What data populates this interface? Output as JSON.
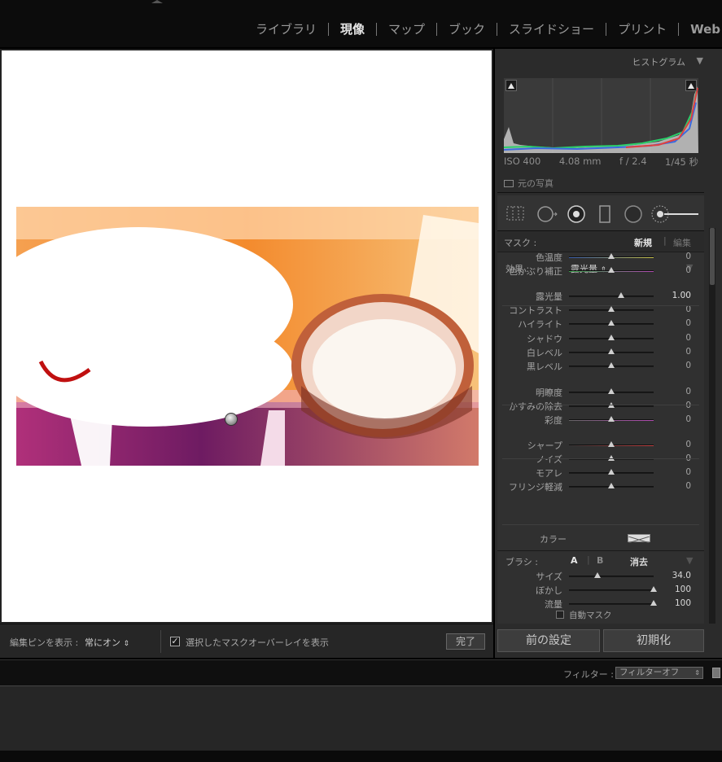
{
  "modules": [
    {
      "label": "ライブラリ",
      "active": false
    },
    {
      "label": "現像",
      "active": true
    },
    {
      "label": "マップ",
      "active": false
    },
    {
      "label": "ブック",
      "active": false
    },
    {
      "label": "スライドショー",
      "active": false
    },
    {
      "label": "プリント",
      "active": false
    },
    {
      "label": "Web",
      "active": false
    }
  ],
  "histogram": {
    "title": "ヒストグラム",
    "iso": "ISO 400",
    "focal": "4.08 mm",
    "aperture": "f / 2.4",
    "shutter": "1/45 秒",
    "original_label": "元の写真"
  },
  "mask": {
    "label": "マスク :",
    "new": "新規",
    "edit": "編集"
  },
  "effect": {
    "label": "効果 :",
    "preset": "露光量",
    "color_label": "カラー"
  },
  "sliders": [
    {
      "label": "色温度",
      "value": "0",
      "pos": 0.5,
      "style": "temp"
    },
    {
      "label": "色かぶり補正",
      "value": "0",
      "pos": 0.5,
      "style": "tint"
    },
    {
      "label": "露光量",
      "value": "1.00",
      "pos": 0.62,
      "style": "plain",
      "bright": true
    },
    {
      "label": "コントラスト",
      "value": "0",
      "pos": 0.5,
      "style": "plain"
    },
    {
      "label": "ハイライト",
      "value": "0",
      "pos": 0.5,
      "style": "plain"
    },
    {
      "label": "シャドウ",
      "value": "0",
      "pos": 0.5,
      "style": "plain"
    },
    {
      "label": "白レベル",
      "value": "0",
      "pos": 0.5,
      "style": "plain"
    },
    {
      "label": "黒レベル",
      "value": "0",
      "pos": 0.5,
      "style": "plain"
    },
    {
      "label": "明瞭度",
      "value": "0",
      "pos": 0.5,
      "style": "plain"
    },
    {
      "label": "かすみの除去",
      "value": "0",
      "pos": 0.5,
      "style": "plain"
    },
    {
      "label": "彩度",
      "value": "0",
      "pos": 0.5,
      "style": "sat"
    },
    {
      "label": "シャープ",
      "value": "0",
      "pos": 0.5,
      "style": "sharp"
    },
    {
      "label": "ノイズ",
      "value": "0",
      "pos": 0.5,
      "style": "plain"
    },
    {
      "label": "モアレ",
      "value": "0",
      "pos": 0.5,
      "style": "plain"
    },
    {
      "label": "フリンジ軽減",
      "value": "0",
      "pos": 0.5,
      "style": "plain"
    }
  ],
  "brush": {
    "label": "ブラシ :",
    "a": "A",
    "b": "B",
    "erase": "消去",
    "sliders": [
      {
        "label": "サイズ",
        "value": "34.0",
        "pos": 0.34
      },
      {
        "label": "ぼかし",
        "value": "100",
        "pos": 1.0
      },
      {
        "label": "流量",
        "value": "100",
        "pos": 1.0
      }
    ],
    "auto_mask": "自動マスク"
  },
  "toolbar": {
    "show_pins_label": "編集ピンを表示 :",
    "show_pins_value": "常にオン",
    "overlay_label": "選択したマスクオーバーレイを表示",
    "overlay_checked": true,
    "done": "完了"
  },
  "buttons": {
    "previous": "前の設定",
    "reset": "初期化"
  },
  "filmstrip": {
    "filter_label": "フィルター :",
    "filter_value": "フィルターオフ"
  },
  "colors": {
    "accent_text": "#e6e6e6",
    "panel_bg": "#2b2b2b"
  }
}
